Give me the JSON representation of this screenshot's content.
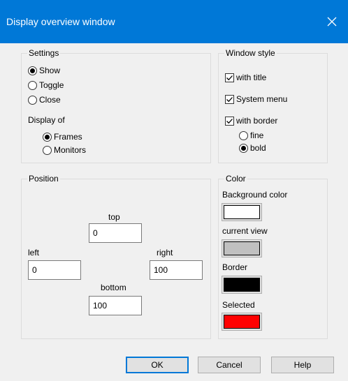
{
  "window": {
    "title": "Display overview window"
  },
  "settings": {
    "group_title": "Settings",
    "options": [
      {
        "label": "Show",
        "selected": true
      },
      {
        "label": "Toggle",
        "selected": false
      },
      {
        "label": "Close",
        "selected": false
      }
    ],
    "display_of_label": "Display of",
    "display_options": [
      {
        "label": "Frames",
        "selected": true
      },
      {
        "label": "Monitors",
        "selected": false
      }
    ]
  },
  "window_style": {
    "group_title": "Window style",
    "checks": [
      {
        "label": "with title",
        "checked": true
      },
      {
        "label": "System menu",
        "checked": true
      },
      {
        "label": "with border",
        "checked": true
      }
    ],
    "border_options": [
      {
        "label": "fine",
        "selected": false
      },
      {
        "label": "bold",
        "selected": true
      }
    ]
  },
  "position": {
    "group_title": "Position",
    "top": {
      "label": "top",
      "value": "0"
    },
    "left": {
      "label": "left",
      "value": "0"
    },
    "right": {
      "label": "right",
      "value": "100"
    },
    "bottom": {
      "label": "bottom",
      "value": "100"
    }
  },
  "color": {
    "group_title": "Color",
    "items": [
      {
        "label": "Background color",
        "color": "#ffffff"
      },
      {
        "label": "current view",
        "color": "#c0c0c0"
      },
      {
        "label": "Border",
        "color": "#000000"
      },
      {
        "label": "Selected",
        "color": "#ff0000"
      }
    ]
  },
  "buttons": {
    "ok": "OK",
    "cancel": "Cancel",
    "help": "Help"
  }
}
